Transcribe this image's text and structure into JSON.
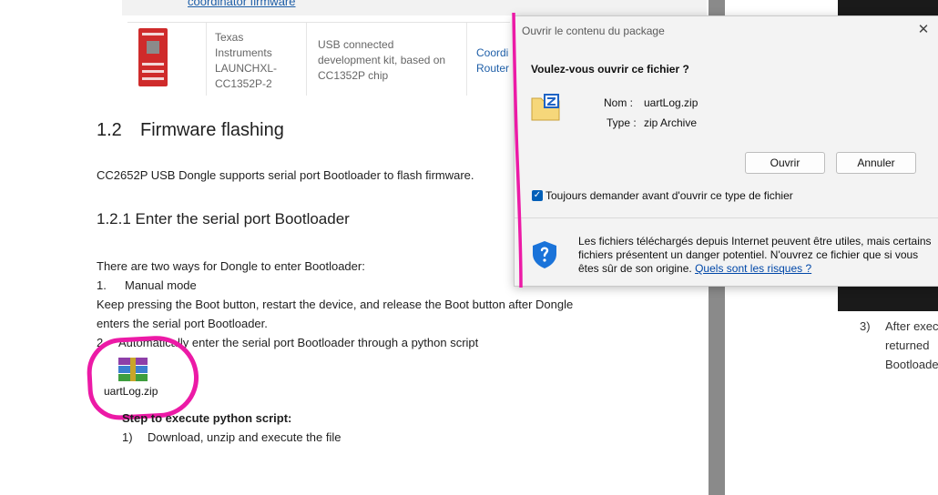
{
  "document": {
    "top_link": "coordinator firmware",
    "table_row": {
      "vendor_lines": [
        "Texas",
        "Instruments",
        "LAUNCHXL-",
        "CC1352P-2"
      ],
      "description_lines": [
        "USB connected",
        "development kit, based on",
        "CC1352P chip"
      ],
      "role_lines": [
        "Coordi",
        "Router"
      ]
    },
    "section_number": "1.2",
    "section_title": "Firmware flashing",
    "intro": "CC2652P USB Dongle supports serial port Bootloader to flash firmware.",
    "subsection_title": "1.2.1 Enter the serial port Bootloader",
    "ways_intro": "There are two ways for Dongle to enter Bootloader:",
    "item1_num": "1.",
    "item1_text": "Manual mode",
    "manual_line1": "Keep pressing the Boot button, restart the device, and release the Boot button after Dongle",
    "manual_line2": "enters the serial port Bootloader.",
    "item2_num": "2.",
    "item2_text": "Automatically enter the serial port Bootloader through a python script",
    "attachment_label": "uartLog.zip",
    "step_title": "Step to execute python script:",
    "step1_num": "1)",
    "step1_text": "Download, unzip and execute the file"
  },
  "right_page": {
    "item_num": "3)",
    "lines": [
      "After exec",
      "returned",
      "Bootloade"
    ]
  },
  "dialog": {
    "title": "Ouvrir le contenu du package",
    "close_glyph": "✕",
    "question": "Voulez-vous ouvrir ce fichier ?",
    "name_label": "Nom :",
    "name_value": "uartLog.zip",
    "type_label": "Type :",
    "type_value": "zip Archive",
    "open_button": "Ouvrir",
    "cancel_button": "Annuler",
    "checkbox_checked": true,
    "checkbox_glyph": "✓",
    "checkbox_label": "Toujours demander avant d'ouvrir ce type de fichier",
    "warning_line1": "Les fichiers téléchargés depuis Internet peuvent être utiles, mais certains",
    "warning_line2": "fichiers présentent un danger potentiel. N'ouvrez ce fichier que si vous",
    "warning_line3": "êtes sûr de son origine.",
    "risks_link": "Quels sont les risques ?"
  },
  "colors": {
    "annotation_pink": "#ec1aa6",
    "link_blue": "#1f5fa8",
    "checkbox_blue": "#005fb8",
    "shield_blue": "#1a73d9"
  }
}
